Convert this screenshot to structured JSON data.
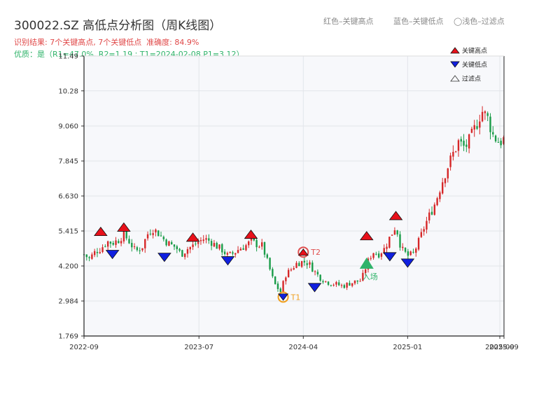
{
  "title": "300022.SZ 高低点分析图（周K线图）",
  "result_line": "识别结果: 7个关键高点, 7个关键低点  准确度: 84.9%",
  "quality_line": "优质：是（R1=47.0%, R2=1.19 ; T1=2024-02-08 P1=3.12）",
  "top_legend": {
    "red": "红色–关键高点",
    "blue": "蓝色–关键低点",
    "hollow": "◯浅色–过滤点"
  },
  "colors": {
    "up": "#d62728",
    "down": "#1a9c49",
    "high_marker": "#e8101a",
    "low_marker": "#1020e0",
    "t_marker": "#f0a020",
    "t2_marker": "#e05050",
    "entry_marker": "#2fb36a",
    "plot_bg": "#f7f8fb",
    "grid": "#e2e5ea"
  },
  "chart_data": {
    "type": "candlestick",
    "ylim": [
      1.769,
      11.49
    ],
    "yticks": [
      "1.769",
      "2.984",
      "4.200",
      "5.415",
      "6.630",
      "7.845",
      "9.060",
      "10.28",
      "11.49"
    ],
    "xlim": [
      "2022-09-01",
      "2025-09-12"
    ],
    "xticks": [
      {
        "date": "2022-09-01",
        "label": "2022-09"
      },
      {
        "date": "2023-07-01",
        "label": "2023-07"
      },
      {
        "date": "2024-04-01",
        "label": "2024-04"
      },
      {
        "date": "2025-01-01",
        "label": "2025-01"
      },
      {
        "date": "2025-09-01",
        "label": "2025-09"
      },
      {
        "date": "2025-09-12",
        "label": "2025-09"
      }
    ],
    "legend": [
      {
        "label": "关键高点",
        "marker": "high"
      },
      {
        "label": "关键低点",
        "marker": "low"
      },
      {
        "label": "过滤点",
        "marker": "filtered"
      }
    ],
    "closes": [
      [
        2022,
        9,
        1,
        4.6
      ],
      [
        2022,
        9,
        15,
        4.45
      ],
      [
        2022,
        10,
        1,
        4.7
      ],
      [
        2022,
        10,
        15,
        4.8
      ],
      [
        2022,
        11,
        1,
        5.05
      ],
      [
        2022,
        11,
        15,
        5.0
      ],
      [
        2022,
        12,
        1,
        5.1
      ],
      [
        2022,
        12,
        15,
        5.3
      ],
      [
        2023,
        1,
        1,
        5.0
      ],
      [
        2023,
        1,
        15,
        4.7
      ],
      [
        2023,
        2,
        1,
        4.85
      ],
      [
        2023,
        2,
        15,
        5.3
      ],
      [
        2023,
        3,
        1,
        5.5
      ],
      [
        2023,
        3,
        15,
        5.35
      ],
      [
        2023,
        4,
        1,
        5.1
      ],
      [
        2023,
        4,
        15,
        4.95
      ],
      [
        2023,
        5,
        1,
        4.85
      ],
      [
        2023,
        5,
        15,
        4.6
      ],
      [
        2023,
        6,
        1,
        4.8
      ],
      [
        2023,
        6,
        15,
        4.9
      ],
      [
        2023,
        7,
        1,
        5.05
      ],
      [
        2023,
        7,
        15,
        5.15
      ],
      [
        2023,
        8,
        1,
        5.05
      ],
      [
        2023,
        8,
        15,
        4.9
      ],
      [
        2023,
        9,
        1,
        4.75
      ],
      [
        2023,
        9,
        15,
        4.55
      ],
      [
        2023,
        10,
        1,
        4.65
      ],
      [
        2023,
        10,
        15,
        4.8
      ],
      [
        2023,
        11,
        1,
        4.9
      ],
      [
        2023,
        11,
        15,
        5.05
      ],
      [
        2023,
        12,
        1,
        4.95
      ],
      [
        2023,
        12,
        15,
        4.9
      ],
      [
        2024,
        1,
        1,
        4.2
      ],
      [
        2024,
        1,
        15,
        3.6
      ],
      [
        2024,
        2,
        1,
        3.3
      ],
      [
        2024,
        2,
        15,
        3.9
      ],
      [
        2024,
        3,
        1,
        4.1
      ],
      [
        2024,
        3,
        15,
        4.3
      ],
      [
        2024,
        4,
        1,
        4.35
      ],
      [
        2024,
        4,
        15,
        4.3
      ],
      [
        2024,
        5,
        1,
        4.0
      ],
      [
        2024,
        5,
        15,
        3.8
      ],
      [
        2024,
        6,
        1,
        3.65
      ],
      [
        2024,
        6,
        15,
        3.6
      ],
      [
        2024,
        7,
        1,
        3.55
      ],
      [
        2024,
        7,
        15,
        3.5
      ],
      [
        2024,
        8,
        1,
        3.6
      ],
      [
        2024,
        8,
        15,
        3.65
      ],
      [
        2024,
        9,
        1,
        3.7
      ],
      [
        2024,
        9,
        15,
        4.25
      ],
      [
        2024,
        10,
        1,
        4.7
      ],
      [
        2024,
        10,
        15,
        4.6
      ],
      [
        2024,
        11,
        1,
        4.8
      ],
      [
        2024,
        11,
        15,
        5.2
      ],
      [
        2024,
        12,
        1,
        5.6
      ],
      [
        2024,
        12,
        15,
        4.8
      ],
      [
        2025,
        1,
        1,
        4.55
      ],
      [
        2025,
        1,
        15,
        4.6
      ],
      [
        2025,
        2,
        1,
        5.1
      ],
      [
        2025,
        2,
        15,
        5.6
      ],
      [
        2025,
        3,
        1,
        6.0
      ],
      [
        2025,
        3,
        15,
        6.4
      ],
      [
        2025,
        4,
        1,
        7.1
      ],
      [
        2025,
        4,
        15,
        7.6
      ],
      [
        2025,
        5,
        1,
        8.1
      ],
      [
        2025,
        5,
        15,
        8.5
      ],
      [
        2025,
        6,
        1,
        8.3
      ],
      [
        2025,
        6,
        15,
        8.6
      ],
      [
        2025,
        7,
        1,
        9.1
      ],
      [
        2025,
        7,
        15,
        9.6
      ],
      [
        2025,
        8,
        1,
        9.3
      ],
      [
        2025,
        8,
        15,
        8.7
      ],
      [
        2025,
        9,
        1,
        8.5
      ],
      [
        2025,
        9,
        12,
        8.6
      ]
    ],
    "key_highs": [
      {
        "date": "2022-10-15",
        "value": 5.4
      },
      {
        "date": "2022-12-15",
        "value": 5.55
      },
      {
        "date": "2023-06-15",
        "value": 5.2
      },
      {
        "date": "2023-11-15",
        "value": 5.3
      },
      {
        "date": "2024-09-15",
        "value": 5.25
      },
      {
        "date": "2024-12-01",
        "value": 5.95
      }
    ],
    "key_lows": [
      {
        "date": "2022-11-15",
        "value": 4.6
      },
      {
        "date": "2023-04-01",
        "value": 4.5
      },
      {
        "date": "2023-09-15",
        "value": 4.38
      },
      {
        "date": "2024-05-01",
        "value": 3.45
      },
      {
        "date": "2024-11-15",
        "value": 4.52
      },
      {
        "date": "2025-01-01",
        "value": 4.3
      }
    ],
    "t1": {
      "label": "T1",
      "date": "2024-02-08",
      "value": 3.12
    },
    "t2": {
      "label": "T2",
      "date": "2024-04-01",
      "value": 4.68
    },
    "entry": {
      "label": "入场",
      "date": "2024-09-15",
      "value": 4.25
    }
  }
}
